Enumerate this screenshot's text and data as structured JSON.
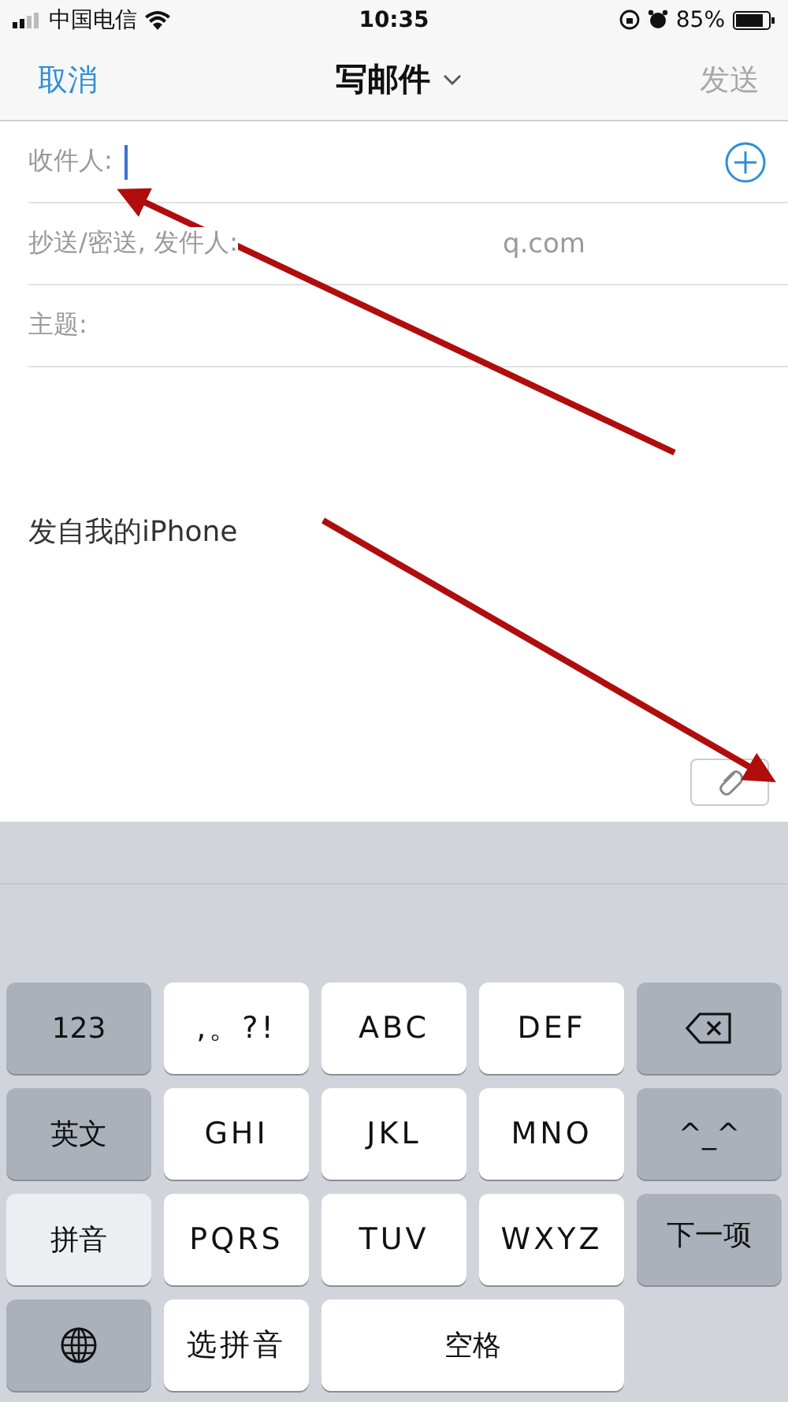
{
  "status_bar": {
    "carrier": "中国电信",
    "time": "10:35",
    "battery": "85%"
  },
  "nav": {
    "cancel": "取消",
    "title": "写邮件",
    "send": "发送",
    "send_disabled": true
  },
  "fields": [
    {
      "label": "收件人:",
      "focused": true,
      "add_button": true
    },
    {
      "label": "抄送/密送, 发件人:",
      "value": "q.com",
      "focused": false,
      "add_button": false
    },
    {
      "label": "主题:",
      "focused": false,
      "add_button": false
    }
  ],
  "body": {
    "signature": "发自我的iPhone"
  },
  "keyboard": {
    "keys": [
      {
        "kind": "function",
        "label": "123"
      },
      {
        "kind": "letter",
        "label": ",。?!"
      },
      {
        "kind": "letter",
        "label": "ABC"
      },
      {
        "kind": "letter",
        "label": "DEF"
      },
      {
        "kind": "delete"
      },
      {
        "kind": "function",
        "label": "英文"
      },
      {
        "kind": "letter",
        "label": "GHI"
      },
      {
        "kind": "letter",
        "label": "JKL"
      },
      {
        "kind": "letter",
        "label": "MNO"
      },
      {
        "kind": "function",
        "label": "^_^"
      },
      {
        "kind": "selected",
        "label": "拼音"
      },
      {
        "kind": "letter",
        "label": "PQRS"
      },
      {
        "kind": "letter",
        "label": "TUV"
      },
      {
        "kind": "letter",
        "label": "WXYZ"
      },
      {
        "kind": "next",
        "label": "下一项"
      },
      {
        "kind": "globe"
      },
      {
        "kind": "letter",
        "label": "选拼音"
      },
      {
        "kind": "space",
        "label": "空格"
      }
    ]
  },
  "annotations": [
    {
      "kind": "arrow"
    },
    {
      "kind": "arrow"
    }
  ]
}
